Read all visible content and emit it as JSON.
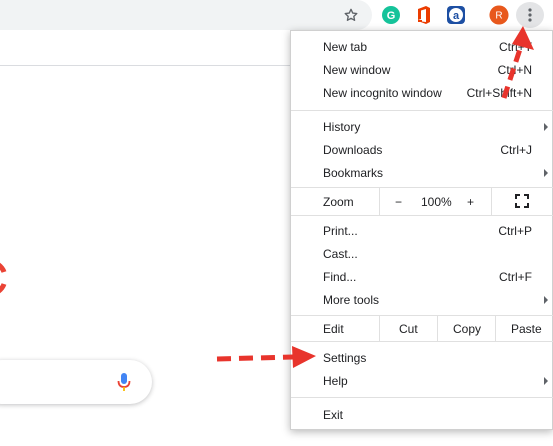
{
  "menu": {
    "new_tab": {
      "label": "New tab",
      "shortcut": "Ctrl+T"
    },
    "new_window": {
      "label": "New window",
      "shortcut": "Ctrl+N"
    },
    "new_incognito": {
      "label": "New incognito window",
      "shortcut": "Ctrl+Shift+N"
    },
    "history": {
      "label": "History"
    },
    "downloads": {
      "label": "Downloads",
      "shortcut": "Ctrl+J"
    },
    "bookmarks": {
      "label": "Bookmarks"
    },
    "zoom": {
      "label": "Zoom",
      "minus": "−",
      "value": "100%",
      "plus": "+"
    },
    "print": {
      "label": "Print...",
      "shortcut": "Ctrl+P"
    },
    "cast": {
      "label": "Cast..."
    },
    "find": {
      "label": "Find...",
      "shortcut": "Ctrl+F"
    },
    "more_tools": {
      "label": "More tools"
    },
    "edit": {
      "label": "Edit",
      "cut": "Cut",
      "copy": "Copy",
      "paste": "Paste"
    },
    "settings": {
      "label": "Settings"
    },
    "help": {
      "label": "Help"
    },
    "exit": {
      "label": "Exit"
    }
  },
  "toolbar": {
    "avatar_letter": "R",
    "grammarly_letter": "G",
    "ext_a_letter": "a"
  },
  "icons": [
    "star-icon",
    "grammarly-icon",
    "office-icon",
    "extension-a-icon",
    "avatar",
    "more-vert-icon",
    "mic-icon",
    "fullscreen-icon"
  ],
  "colors": {
    "annotation_red": "#e8342c",
    "avatar_orange": "#e8581c",
    "grammarly_green": "#15c39a",
    "toolbar_gray": "#f1f3f4"
  }
}
